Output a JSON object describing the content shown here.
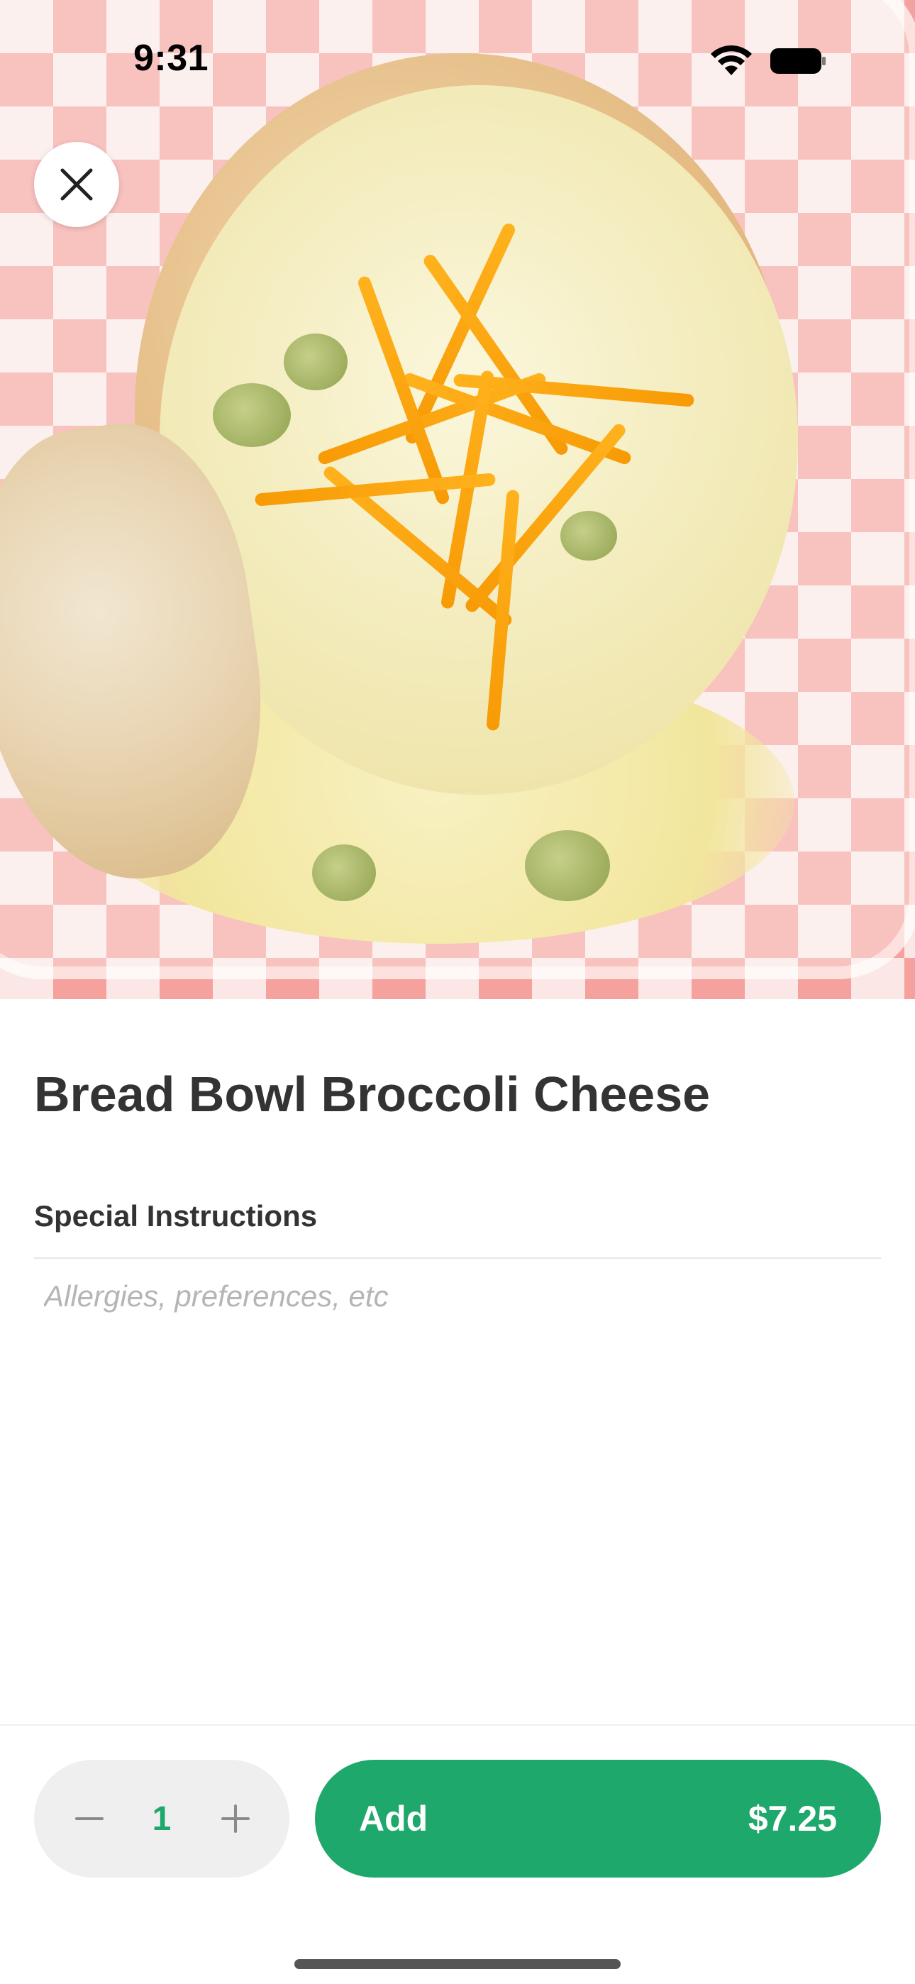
{
  "status_bar": {
    "time": "9:31"
  },
  "item": {
    "name": "Bread Bowl Broccoli Cheese"
  },
  "special_instructions": {
    "label": "Special Instructions",
    "placeholder": "Allergies, preferences, etc",
    "value": ""
  },
  "quantity": {
    "value": "1"
  },
  "add_button": {
    "label": "Add",
    "price": "$7.25"
  },
  "colors": {
    "accent": "#1ea86b",
    "text": "#333333",
    "placeholder": "#b5b5b5",
    "stepper_bg": "#efefef"
  },
  "icons": [
    "close-icon",
    "minus-icon",
    "plus-icon",
    "wifi-icon",
    "battery-icon"
  ]
}
